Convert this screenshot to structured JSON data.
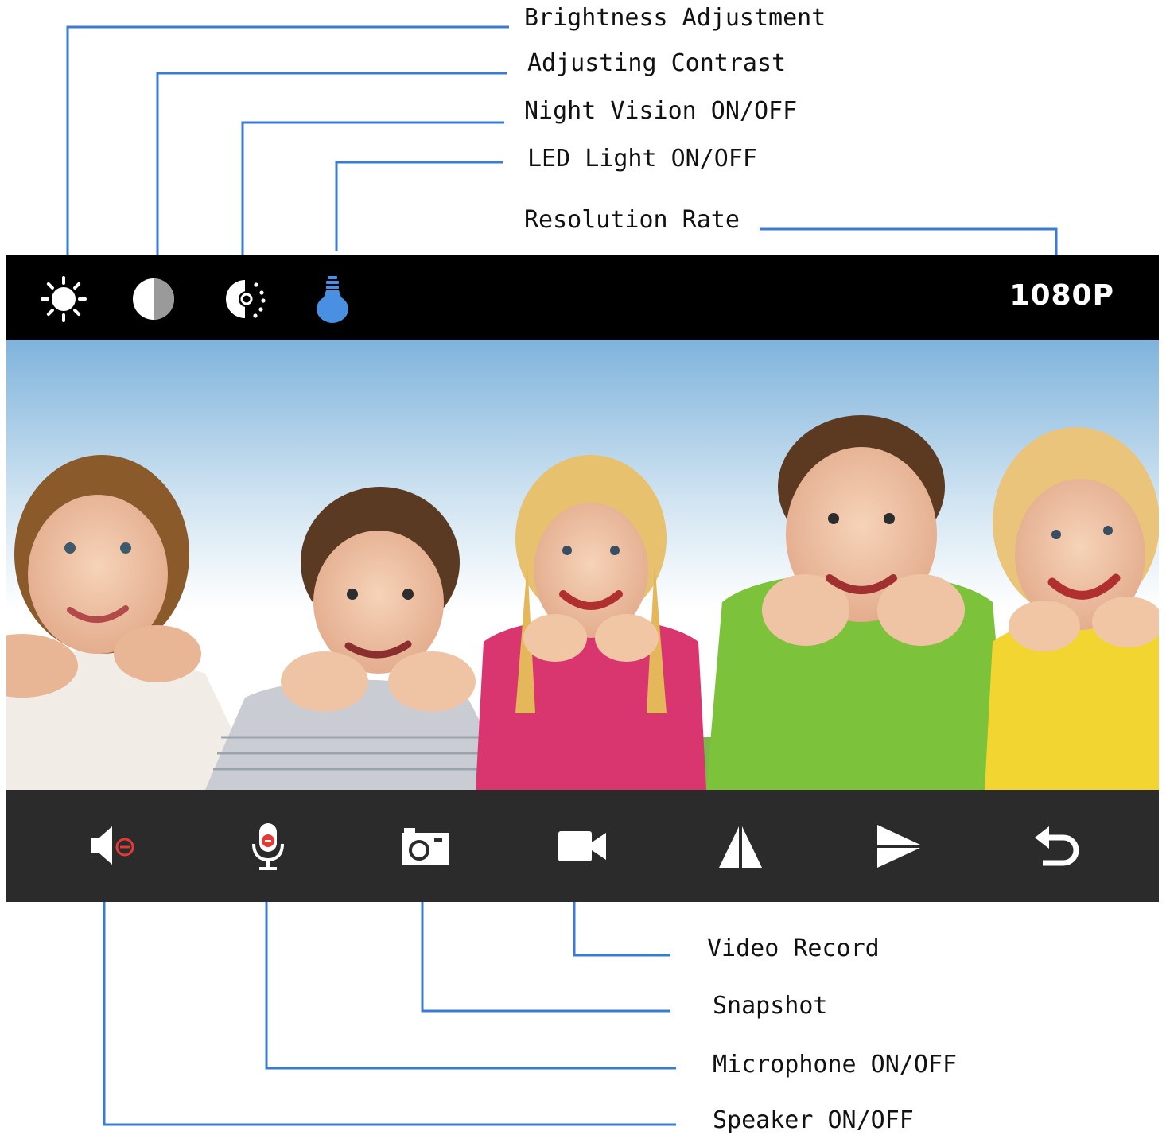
{
  "callouts": {
    "brightness": "Brightness Adjustment",
    "contrast": "Adjusting Contrast",
    "night_vision": "Night Vision ON/OFF",
    "led_light": "LED Light ON/OFF",
    "resolution": "Resolution Rate",
    "video_record": "Video Record",
    "snapshot": "Snapshot",
    "microphone": "Microphone ON/OFF",
    "speaker": "Speaker ON/OFF"
  },
  "top_toolbar": {
    "resolution_value": "1080P",
    "icons": [
      "sun-icon",
      "contrast-icon",
      "night-vision-icon",
      "bulb-icon"
    ]
  },
  "bottom_toolbar": {
    "icons": [
      "speaker-muted-icon",
      "microphone-icon",
      "camera-icon",
      "video-camera-icon",
      "flip-horizontal-icon",
      "flip-vertical-icon",
      "back-icon"
    ]
  },
  "colors": {
    "leader_line": "#3a7bd5",
    "bulb_active": "#4a90e2",
    "mute_red": "#e53935",
    "top_bar": "#000000",
    "bottom_bar": "#2b2b2b"
  }
}
